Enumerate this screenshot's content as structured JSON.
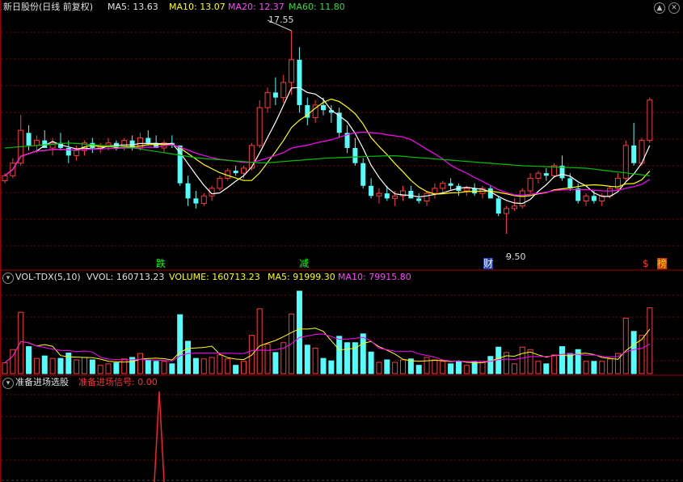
{
  "price_panel": {
    "title": "新日股份(日线 前复权)",
    "ma5": "MA5: 13.63",
    "ma10": "MA10: 13.07",
    "ma20": "MA20: 12.37",
    "ma60": "MA60: 11.80",
    "high_label": "17.55",
    "low_label": "9.50",
    "markers": [
      "跌",
      "减",
      "财",
      "$",
      "榜"
    ]
  },
  "volume_panel": {
    "title": "VOL-TDX(5,10)",
    "vvol": "VVOL: 160713.23",
    "volume": "VOLUME: 160713.23",
    "ma5": "MA5: 91999.30",
    "ma10": "MA10: 79915.80"
  },
  "signal_panel": {
    "title": "准备进场选股",
    "signal": "准备进场信号: 0.00"
  },
  "colors": {
    "up": "#ff3b3b",
    "down": "#54fcfc",
    "ma5": "#ffffff",
    "ma10": "#ffff00",
    "ma20": "#ff00ff",
    "ma60": "#00c000",
    "grid": "#7a0000",
    "signal": "#ff2020"
  },
  "chart_data": {
    "type": "candlestick",
    "price_range": [
      9.5,
      17.55
    ],
    "candles": [
      [
        11.6,
        11.9,
        11.5,
        11.8
      ],
      [
        11.8,
        12.5,
        11.7,
        12.3
      ],
      [
        12.3,
        14.2,
        12.2,
        13.6
      ],
      [
        13.5,
        13.8,
        12.8,
        13.0
      ],
      [
        13.0,
        13.4,
        12.7,
        13.2
      ],
      [
        13.2,
        13.6,
        12.9,
        12.9
      ],
      [
        12.9,
        13.3,
        12.6,
        13.1
      ],
      [
        13.1,
        13.5,
        12.8,
        12.9
      ],
      [
        12.9,
        13.2,
        12.3,
        12.6
      ],
      [
        12.6,
        13.0,
        12.4,
        12.8
      ],
      [
        12.8,
        13.2,
        12.6,
        13.1
      ],
      [
        13.1,
        13.3,
        12.7,
        12.9
      ],
      [
        12.9,
        13.1,
        12.7,
        13.0
      ],
      [
        13.0,
        13.3,
        12.8,
        13.1
      ],
      [
        13.1,
        13.2,
        12.8,
        12.9
      ],
      [
        12.9,
        13.3,
        12.8,
        13.2
      ],
      [
        13.2,
        13.4,
        12.8,
        12.9
      ],
      [
        12.9,
        13.5,
        12.8,
        13.3
      ],
      [
        13.3,
        13.6,
        13.0,
        13.1
      ],
      [
        13.1,
        13.4,
        12.9,
        12.9
      ],
      [
        12.9,
        13.2,
        12.7,
        13.1
      ],
      [
        13.1,
        13.4,
        12.9,
        13.0
      ],
      [
        13.0,
        12.9,
        11.4,
        11.5
      ],
      [
        11.5,
        11.8,
        10.6,
        10.9
      ],
      [
        10.9,
        11.2,
        10.5,
        10.7
      ],
      [
        10.7,
        11.1,
        10.6,
        11.0
      ],
      [
        11.0,
        11.4,
        10.8,
        11.3
      ],
      [
        11.3,
        11.8,
        11.2,
        11.7
      ],
      [
        11.7,
        12.1,
        11.6,
        12.0
      ],
      [
        12.0,
        12.2,
        11.8,
        11.9
      ],
      [
        11.9,
        12.2,
        11.7,
        12.1
      ],
      [
        12.1,
        13.1,
        12.0,
        13.0
      ],
      [
        13.0,
        14.8,
        12.9,
        14.5
      ],
      [
        14.5,
        15.3,
        14.3,
        15.1
      ],
      [
        15.1,
        15.7,
        14.6,
        14.9
      ],
      [
        14.9,
        15.8,
        14.7,
        15.5
      ],
      [
        15.5,
        17.55,
        15.0,
        16.4
      ],
      [
        16.4,
        16.9,
        14.3,
        14.6
      ],
      [
        14.6,
        14.9,
        13.8,
        14.1
      ],
      [
        14.1,
        14.8,
        13.9,
        14.6
      ],
      [
        14.6,
        14.9,
        14.2,
        14.4
      ],
      [
        14.4,
        14.6,
        13.9,
        14.3
      ],
      [
        14.3,
        14.5,
        13.3,
        13.5
      ],
      [
        13.5,
        13.8,
        12.7,
        12.9
      ],
      [
        12.9,
        13.3,
        12.2,
        12.3
      ],
      [
        12.3,
        12.5,
        11.3,
        11.4
      ],
      [
        11.4,
        11.7,
        10.9,
        11.0
      ],
      [
        11.0,
        11.3,
        10.7,
        11.1
      ],
      [
        11.1,
        11.4,
        10.8,
        10.9
      ],
      [
        10.9,
        11.2,
        10.6,
        11.0
      ],
      [
        11.0,
        11.4,
        10.8,
        11.2
      ],
      [
        11.2,
        11.4,
        10.9,
        10.9
      ],
      [
        10.9,
        11.1,
        10.7,
        10.8
      ],
      [
        10.8,
        11.2,
        10.6,
        11.1
      ],
      [
        11.1,
        11.5,
        10.9,
        11.3
      ],
      [
        11.3,
        11.6,
        11.1,
        11.5
      ],
      [
        11.5,
        11.7,
        11.2,
        11.4
      ],
      [
        11.4,
        11.5,
        11.0,
        11.2
      ],
      [
        11.2,
        11.4,
        11.0,
        11.3
      ],
      [
        11.3,
        11.5,
        11.0,
        11.1
      ],
      [
        11.1,
        11.4,
        10.9,
        11.3
      ],
      [
        11.3,
        11.4,
        10.9,
        10.9
      ],
      [
        10.9,
        11.0,
        10.2,
        10.3
      ],
      [
        10.3,
        10.6,
        9.5,
        10.5
      ],
      [
        10.5,
        10.9,
        10.4,
        10.6
      ],
      [
        10.6,
        11.3,
        10.5,
        11.2
      ],
      [
        11.2,
        11.9,
        11.1,
        11.7
      ],
      [
        11.7,
        12.0,
        11.5,
        11.9
      ],
      [
        11.9,
        12.1,
        11.6,
        11.8
      ],
      [
        11.8,
        12.3,
        11.7,
        12.2
      ],
      [
        12.2,
        12.6,
        11.6,
        11.7
      ],
      [
        11.7,
        11.9,
        11.2,
        11.3
      ],
      [
        11.3,
        11.5,
        10.7,
        10.8
      ],
      [
        10.8,
        11.1,
        10.6,
        11.0
      ],
      [
        11.0,
        11.2,
        10.7,
        10.8
      ],
      [
        10.8,
        11.1,
        10.6,
        11.0
      ],
      [
        11.0,
        11.4,
        10.9,
        11.3
      ],
      [
        11.3,
        11.9,
        11.2,
        11.7
      ],
      [
        11.7,
        13.2,
        11.6,
        13.0
      ],
      [
        13.0,
        13.9,
        12.2,
        12.3
      ],
      [
        12.3,
        13.3,
        12.2,
        13.2
      ],
      [
        13.2,
        14.9,
        13.1,
        14.8
      ]
    ],
    "ma60_anchors": [
      12.9,
      13.1,
      12.9,
      12.5,
      12.3,
      12.5,
      12.6,
      12.4,
      12.2,
      12.1,
      11.8
    ]
  }
}
